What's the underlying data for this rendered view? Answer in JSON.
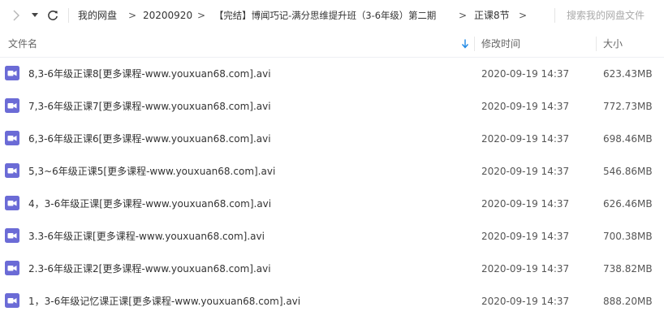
{
  "toolbar": {
    "back_icon": "chevron-right-icon",
    "dropdown_icon": "caret-down-icon",
    "refresh_icon": "refresh-icon"
  },
  "breadcrumbs": [
    "我的网盘",
    "20200920",
    "【完结】博闻巧记-满分思维提升班（3-6年级）第二期",
    "正课8节"
  ],
  "breadcrumb_separator": ">",
  "search": {
    "placeholder": "搜索我的网盘文件"
  },
  "columns": {
    "name": "文件名",
    "modified": "修改时间",
    "size": "大小"
  },
  "colors": {
    "video_icon": "#6b6bd6",
    "sort_arrow": "#1e88e5"
  },
  "files": [
    {
      "name": "8,3-6年级正课8[更多课程-www.youxuan68.com].avi",
      "modified": "2020-09-19 14:37",
      "size": "623.43MB"
    },
    {
      "name": "7,3-6年级正课7[更多课程-www.youxuan68.com].avi",
      "modified": "2020-09-19 14:37",
      "size": "772.73MB"
    },
    {
      "name": "6,3-6年级正课6[更多课程-www.youxuan68.com].avi",
      "modified": "2020-09-19 14:37",
      "size": "698.46MB"
    },
    {
      "name": "5,3~6年级正课5[更多课程-www.youxuan68.com].avi",
      "modified": "2020-09-19 14:37",
      "size": "546.86MB"
    },
    {
      "name": "4，3-6年级正课[更多课程-www.youxuan68.com].avi",
      "modified": "2020-09-19 14:37",
      "size": "626.46MB"
    },
    {
      "name": "3.3-6年级正课[更多课程-www.youxuan68.com].avi",
      "modified": "2020-09-19 14:37",
      "size": "700.38MB"
    },
    {
      "name": "2.3-6年级正课2[更多课程-www.youxuan68.com].avi",
      "modified": "2020-09-19 14:37",
      "size": "738.82MB"
    },
    {
      "name": "1，3-6年级记忆课正课[更多课程-www.youxuan68.com].avi",
      "modified": "2020-09-19 14:37",
      "size": "888.20MB"
    }
  ]
}
